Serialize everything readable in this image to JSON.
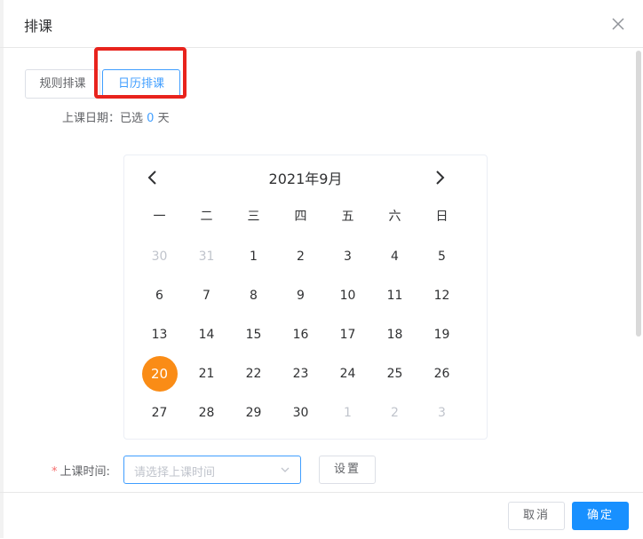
{
  "dialog": {
    "title": "排课"
  },
  "tabs": [
    {
      "label": "规则排课"
    },
    {
      "label": "日历排课"
    }
  ],
  "selected": {
    "label": "上课日期：已选",
    "count": "0",
    "unit": "天"
  },
  "calendar": {
    "month_label": "2021年9月",
    "weekdays": [
      "一",
      "二",
      "三",
      "四",
      "五",
      "六",
      "日"
    ],
    "weeks": [
      [
        {
          "d": "30",
          "muted": true
        },
        {
          "d": "31",
          "muted": true
        },
        {
          "d": "1"
        },
        {
          "d": "2"
        },
        {
          "d": "3"
        },
        {
          "d": "4"
        },
        {
          "d": "5"
        }
      ],
      [
        {
          "d": "6"
        },
        {
          "d": "7"
        },
        {
          "d": "8"
        },
        {
          "d": "9"
        },
        {
          "d": "10"
        },
        {
          "d": "11"
        },
        {
          "d": "12"
        }
      ],
      [
        {
          "d": "13"
        },
        {
          "d": "14"
        },
        {
          "d": "15"
        },
        {
          "d": "16"
        },
        {
          "d": "17"
        },
        {
          "d": "18"
        },
        {
          "d": "19"
        }
      ],
      [
        {
          "d": "20",
          "today": true
        },
        {
          "d": "21"
        },
        {
          "d": "22"
        },
        {
          "d": "23"
        },
        {
          "d": "24"
        },
        {
          "d": "25"
        },
        {
          "d": "26"
        }
      ],
      [
        {
          "d": "27"
        },
        {
          "d": "28"
        },
        {
          "d": "29"
        },
        {
          "d": "30"
        },
        {
          "d": "1",
          "muted": true
        },
        {
          "d": "2",
          "muted": true
        },
        {
          "d": "3",
          "muted": true
        }
      ]
    ]
  },
  "time": {
    "label": "上课时间:",
    "required_mark": "*",
    "placeholder": "请选择上课时间",
    "set_label": "设置"
  },
  "footer": {
    "cancel_label": "取消",
    "ok_label": "确定"
  },
  "colors": {
    "accent": "#409eff",
    "today": "#fa8c16",
    "highlight": "#e8231d",
    "primary_button": "#1890ff"
  }
}
